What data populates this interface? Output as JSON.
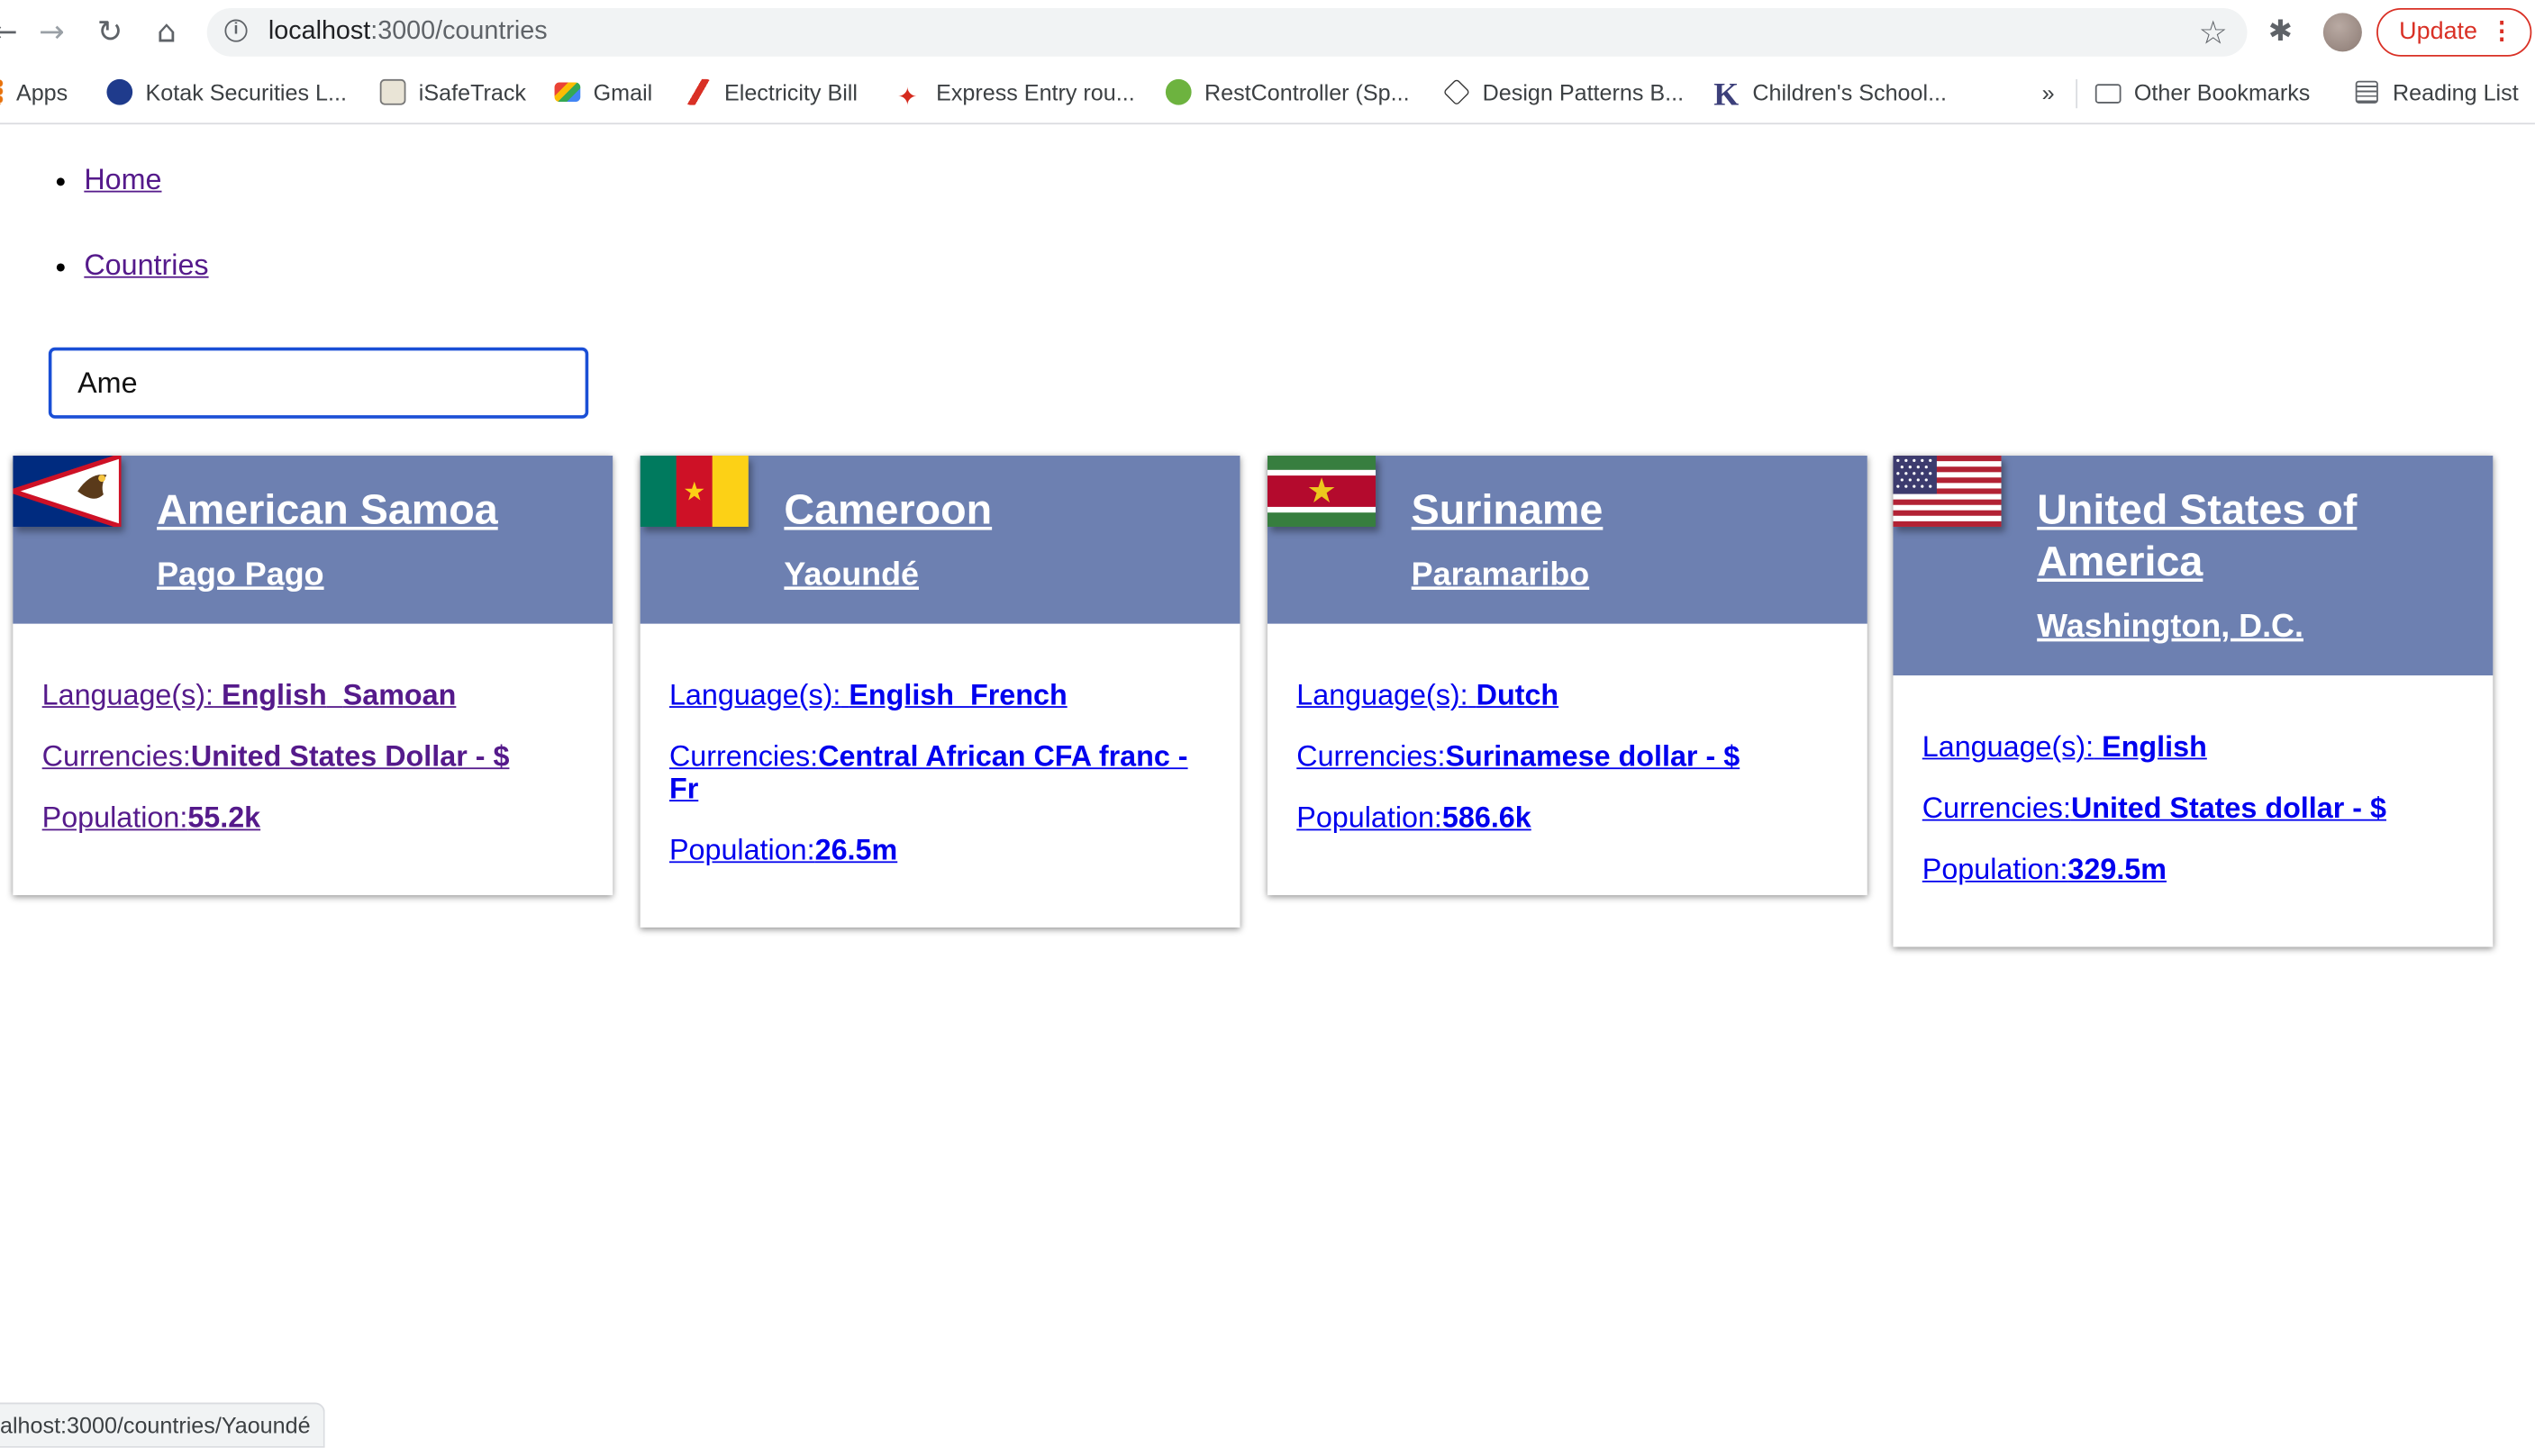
{
  "browser": {
    "url_host": "localhost",
    "url_path": ":3000/countries",
    "update_label": "Update",
    "bookmarks": [
      {
        "label": "Apps",
        "icon": "apps-grid-icon"
      },
      {
        "label": "Kotak Securities L...",
        "icon": "kotak-icon"
      },
      {
        "label": "iSafeTrack",
        "icon": "isafetrack-icon"
      },
      {
        "label": "Gmail",
        "icon": "gmail-icon"
      },
      {
        "label": "Electricity Bill",
        "icon": "electricity-icon"
      },
      {
        "label": "Express Entry rou...",
        "icon": "maple-leaf-icon"
      },
      {
        "label": "RestController (Sp...",
        "icon": "spring-icon"
      },
      {
        "label": "Design Patterns B...",
        "icon": "design-patterns-icon"
      },
      {
        "label": "Children's School...",
        "icon": "k-icon"
      }
    ],
    "overflow_label": "»",
    "other_bookmarks": "Other Bookmarks",
    "reading_list": "Reading List",
    "status_url": "alhost:3000/countries/Yaoundé"
  },
  "nav": {
    "home": "Home",
    "countries": "Countries"
  },
  "search": {
    "value": "Ame"
  },
  "labels": {
    "languages": "Language(s):",
    "currencies": "Currencies:",
    "population": "Population:"
  },
  "countries": [
    {
      "name": "American Samoa",
      "capital": "Pago Pago",
      "languages": [
        "English",
        "Samoan"
      ],
      "currency": "United States Dollar - $",
      "population": "55.2k",
      "visited": true,
      "flag": "american-samoa-flag"
    },
    {
      "name": "Cameroon",
      "capital": "Yaoundé",
      "languages": [
        "English",
        "French"
      ],
      "currency": "Central African CFA franc - Fr",
      "population": "26.5m",
      "visited": false,
      "flag": "cameroon-flag"
    },
    {
      "name": "Suriname",
      "capital": "Paramaribo",
      "languages": [
        "Dutch"
      ],
      "currency": "Surinamese dollar - $",
      "population": "586.6k",
      "visited": false,
      "flag": "suriname-flag"
    },
    {
      "name": "United States of America",
      "capital": "Washington, D.C.",
      "languages": [
        "English"
      ],
      "currency": "United States dollar - $",
      "population": "329.5m",
      "visited": false,
      "flag": "usa-flag"
    }
  ],
  "colors": {
    "card_header": "#6d80b1",
    "link_visited": "#551a8b",
    "link_unvisited": "#0000ee",
    "search_border": "#1a4fd6"
  }
}
